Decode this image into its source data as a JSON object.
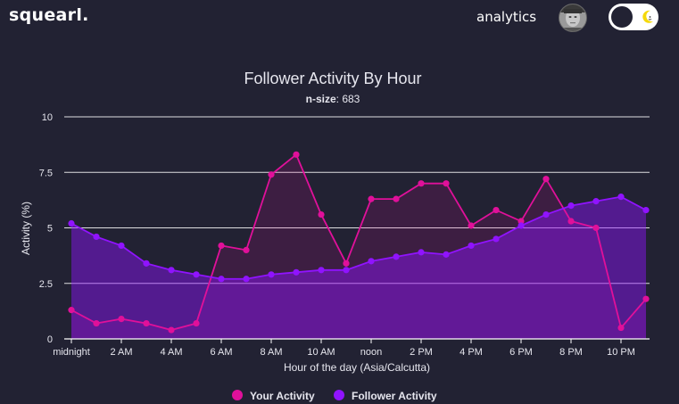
{
  "app": {
    "brand": "squearl.",
    "nav_link": "analytics",
    "avatar_icon": "user-avatar",
    "theme_toggle_icon": "moon-icon"
  },
  "colors": {
    "background": "#222233",
    "your_activity": "#e0109a",
    "follower_activity": "#9013fe",
    "grid": "#ffffff",
    "axis_text": "#e6e6ee"
  },
  "chart_data": {
    "type": "area",
    "title": "Follower Activity By Hour",
    "subtitle_label": "n-size",
    "subtitle_value": "683",
    "xlabel": "Hour of the day (Asia/Calcutta)",
    "ylabel": "Activity (%)",
    "ylim": [
      0,
      10
    ],
    "yticks": [
      "0",
      "2.5",
      "5",
      "7.5",
      "10"
    ],
    "ytick_values": [
      0,
      2.5,
      5,
      7.5,
      10
    ],
    "xtick_labels": [
      "midnight",
      "2 AM",
      "4 AM",
      "6 AM",
      "8 AM",
      "10 AM",
      "noon",
      "2 PM",
      "4 PM",
      "6 PM",
      "8 PM",
      "10 PM"
    ],
    "xtick_hours": [
      0,
      2,
      4,
      6,
      8,
      10,
      12,
      14,
      16,
      18,
      20,
      22
    ],
    "x": [
      0,
      1,
      2,
      3,
      4,
      5,
      6,
      7,
      8,
      9,
      10,
      11,
      12,
      13,
      14,
      15,
      16,
      17,
      18,
      19,
      20,
      21,
      22,
      23
    ],
    "grid": "horizontal",
    "legend_position": "bottom-center",
    "series": [
      {
        "name": "Your Activity",
        "color": "#e0109a",
        "values": [
          1.3,
          0.7,
          0.9,
          0.7,
          0.4,
          0.7,
          4.2,
          4.0,
          7.4,
          8.3,
          5.6,
          3.4,
          6.3,
          6.3,
          7.0,
          7.0,
          5.1,
          5.8,
          5.3,
          7.2,
          5.3,
          5.0,
          0.5,
          1.8
        ]
      },
      {
        "name": "Follower Activity",
        "color": "#9013fe",
        "values": [
          5.2,
          4.6,
          4.2,
          3.4,
          3.1,
          2.9,
          2.7,
          2.7,
          2.9,
          3.0,
          3.1,
          3.1,
          3.5,
          3.7,
          3.9,
          3.8,
          4.2,
          4.5,
          5.1,
          5.6,
          6.0,
          6.2,
          6.4,
          5.8
        ]
      }
    ]
  }
}
